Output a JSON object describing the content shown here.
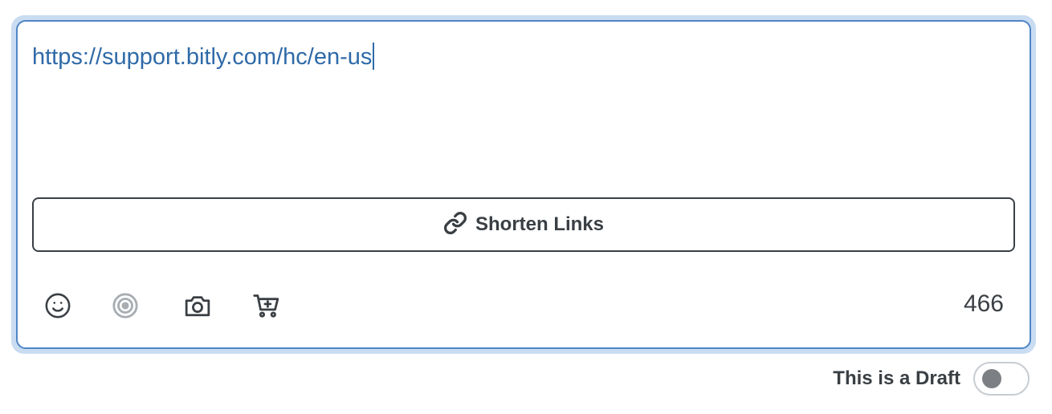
{
  "composer": {
    "text": "https://support.bitly.com/hc/en-us",
    "text_color": "#2f6aa8",
    "border_color": "#4f86c6"
  },
  "shorten_button": {
    "label": "Shorten Links",
    "icon": "link-icon"
  },
  "toolbar": {
    "icons": [
      "emoji-icon",
      "target-icon",
      "camera-icon",
      "cart-icon"
    ],
    "char_count": "466"
  },
  "draft": {
    "label": "This is a Draft",
    "enabled": false
  }
}
